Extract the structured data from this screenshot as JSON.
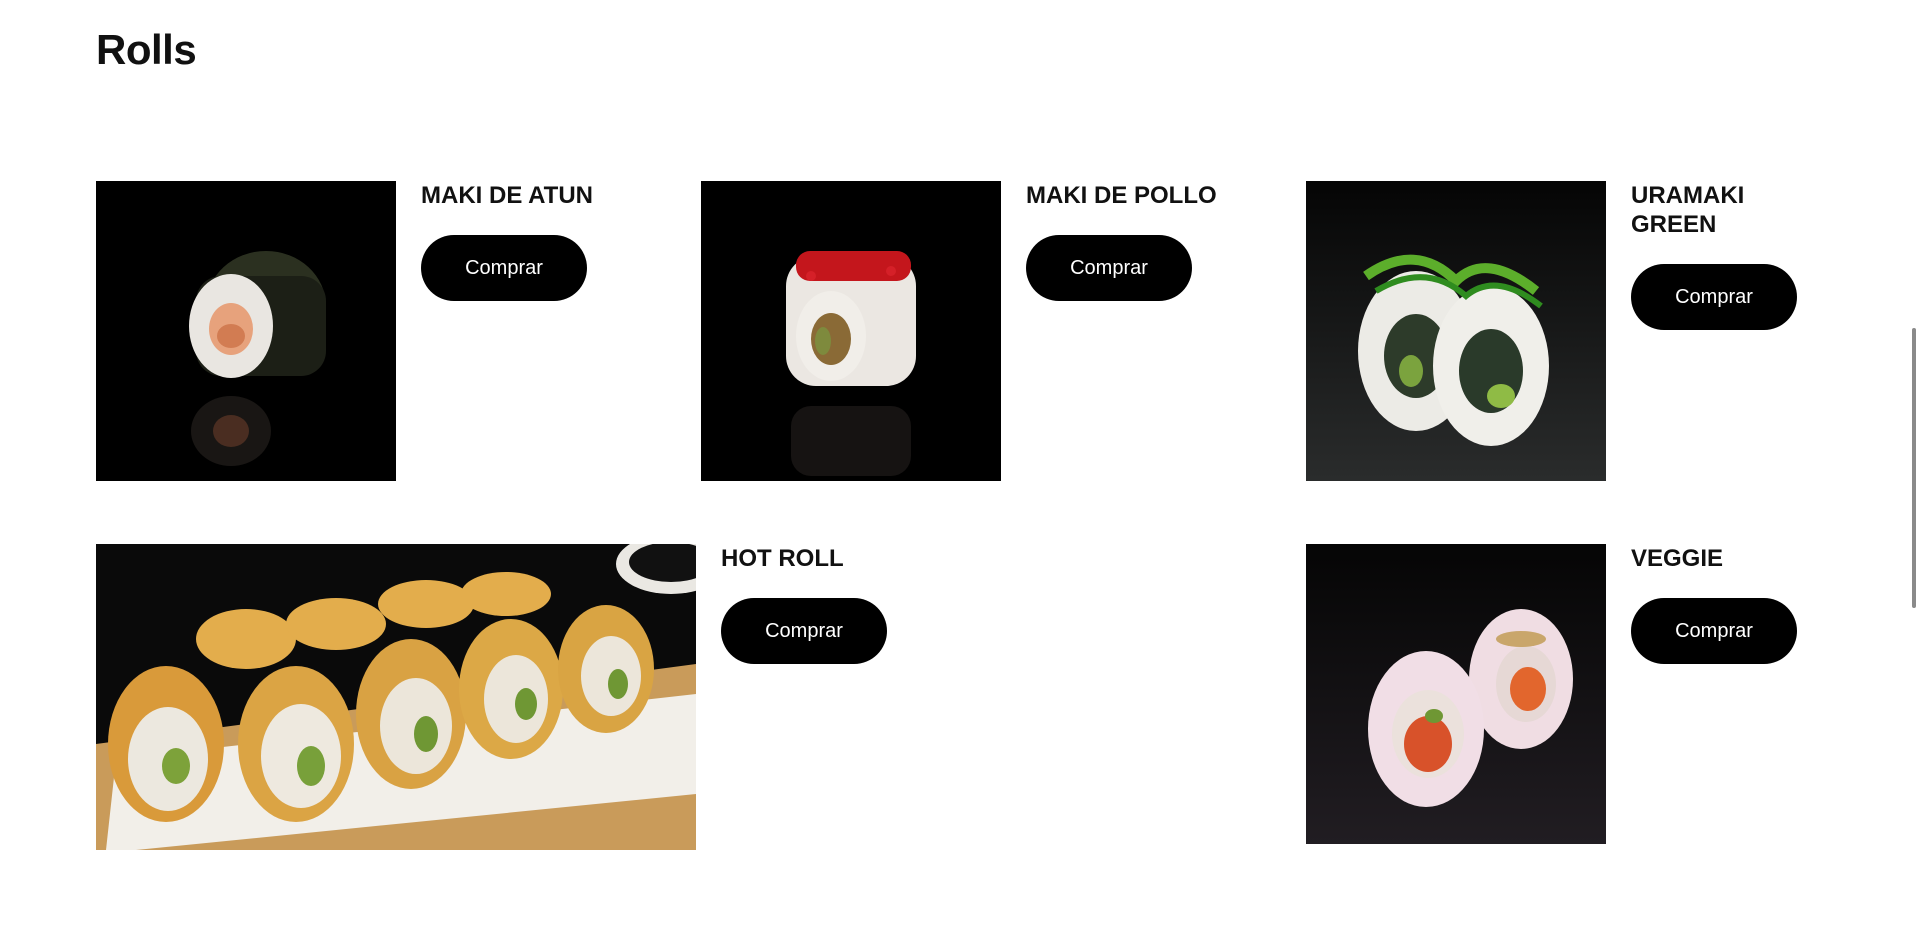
{
  "section": {
    "title": "Rolls"
  },
  "products": [
    {
      "name": "MAKI DE ATUN",
      "button": "Comprar"
    },
    {
      "name": "MAKI DE POLLO",
      "button": "Comprar"
    },
    {
      "name": "URAMAKI GREEN",
      "button": "Comprar"
    },
    {
      "name": "HOT ROLL",
      "button": "Comprar"
    },
    {
      "name": "VEGGIE",
      "button": "Comprar"
    }
  ],
  "colors": {
    "button_bg": "#000000",
    "button_text": "#ffffff",
    "image_bg": "#000000"
  }
}
